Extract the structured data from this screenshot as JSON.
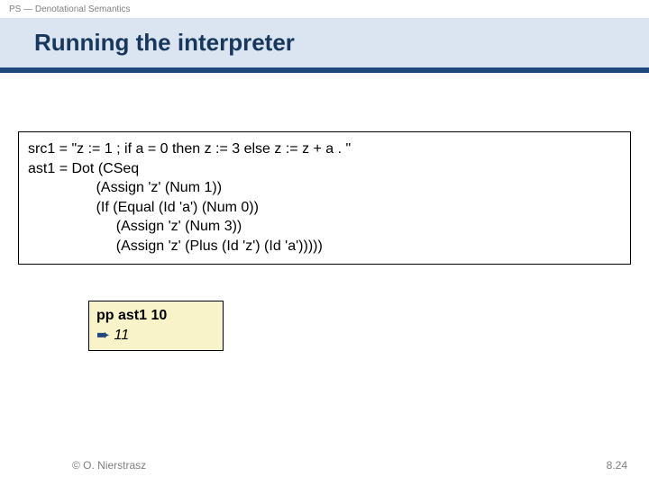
{
  "header": "PS — Denotational Semantics",
  "title": "Running the interpreter",
  "code": "src1 = \"z := 1 ; if a = 0 then z := 3 else z := z + a . \"\nast1 = Dot (CSeq\n                 (Assign 'z' (Num 1))\n                 (If (Equal (Id 'a') (Num 0))\n                      (Assign 'z' (Num 3))\n                      (Assign 'z' (Plus (Id 'z') (Id 'a')))))",
  "result": {
    "command": "pp ast1 10",
    "arrow": "➨",
    "output": "11"
  },
  "footer": {
    "left": "© O. Nierstrasz",
    "right": "8.24"
  }
}
